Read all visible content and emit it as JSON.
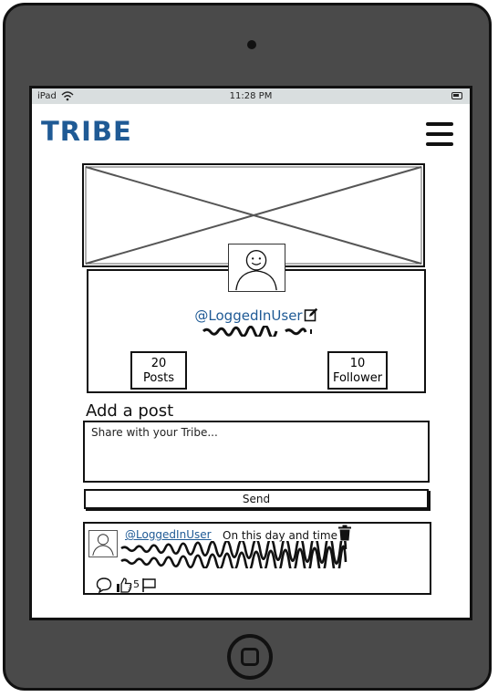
{
  "status_bar": {
    "carrier": "iPad",
    "time": "11:28 PM"
  },
  "app": {
    "brand": "TRIBE"
  },
  "profile": {
    "username": "@LoggedInUser",
    "posts_count": "20",
    "posts_label": "Posts",
    "followers_count": "10",
    "followers_label": "Follower"
  },
  "composer": {
    "title": "Add a post",
    "placeholder": "Share with your Tribe...",
    "send_label": "Send"
  },
  "feed": {
    "posts": [
      {
        "author": "@LoggedInUser",
        "date": "On this day and time",
        "likes": "5"
      }
    ]
  },
  "icons": {
    "menu": "hamburger-menu-icon",
    "edit": "edit-icon",
    "trash": "trash-icon",
    "comment": "comment-icon",
    "like": "thumbs-up-icon",
    "flag": "flag-icon"
  },
  "colors": {
    "brand": "#1f5a95",
    "device": "#4a4a4a",
    "status_bar": "#d9dedf"
  }
}
